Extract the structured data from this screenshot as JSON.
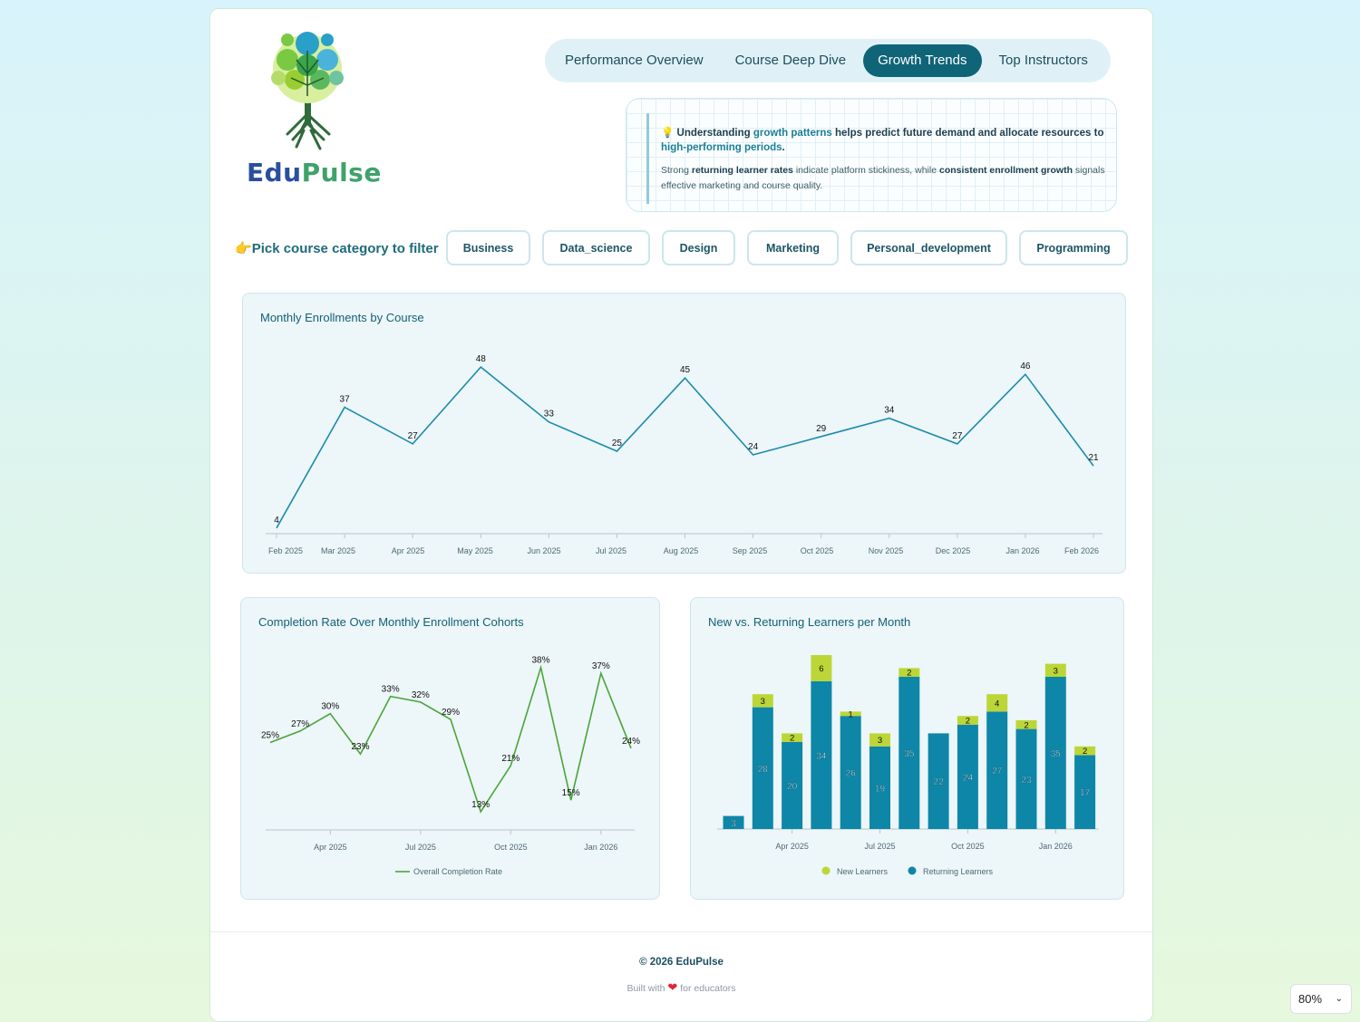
{
  "app": {
    "brand_a": "Edu",
    "brand_b": "Pulse"
  },
  "nav": {
    "tabs": [
      {
        "label": "Performance Overview",
        "active": false
      },
      {
        "label": "Course Deep Dive",
        "active": false
      },
      {
        "label": "Growth Trends",
        "active": true
      },
      {
        "label": "Top Instructors",
        "active": false
      }
    ]
  },
  "insight": {
    "icon": "lightbulb-icon",
    "line1_a": "Understanding ",
    "line1_hl": "growth patterns",
    "line1_b": " helps predict future demand and allocate resources to ",
    "line1_hl2": "high-performing periods",
    "line1_c": ".",
    "line2_a": "Strong ",
    "line2_b1": "returning learner rates",
    "line2_c": " indicate platform stickiness, while ",
    "line2_b2": "consistent enrollment growth",
    "line2_d": " signals effective marketing and course quality."
  },
  "filter": {
    "label": "Pick course category to filter",
    "icon": "pointing-hand-icon",
    "categories": [
      "Business",
      "Data_science",
      "Design",
      "Marketing",
      "Personal_development",
      "Programming"
    ]
  },
  "panels": {
    "enrollments_title": "Monthly Enrollments by Course",
    "completion_title": "Completion Rate Over Monthly Enrollment Cohorts",
    "learners_title": "New vs. Returning Learners per Month"
  },
  "chart_data": [
    {
      "type": "line",
      "title": "Monthly Enrollments by Course",
      "x": [
        "Feb 2025",
        "Mar 2025",
        "Apr 2025",
        "May 2025",
        "Jun 2025",
        "Jul 2025",
        "Aug 2025",
        "Sep 2025",
        "Oct 2025",
        "Nov 2025",
        "Dec 2025",
        "Jan 2026",
        "Feb 2026"
      ],
      "values": [
        4,
        37,
        27,
        48,
        33,
        25,
        45,
        24,
        29,
        34,
        27,
        46,
        21
      ],
      "ylim": [
        0,
        50
      ],
      "color": "#1a8cac"
    },
    {
      "type": "line",
      "title": "Completion Rate Over Monthly Enrollment Cohorts",
      "x": [
        "Feb 2025",
        "Mar 2025",
        "Apr 2025",
        "May 2025",
        "Jun 2025",
        "Jul 2025",
        "Aug 2025",
        "Sep 2025",
        "Oct 2025",
        "Nov 2025",
        "Dec 2025",
        "Jan 2026",
        "Feb 2026"
      ],
      "x_ticks": [
        "Apr 2025",
        "Jul 2025",
        "Oct 2025",
        "Jan 2026"
      ],
      "series": [
        {
          "name": "Overall Completion Rate",
          "values": [
            25,
            27,
            30,
            23,
            33,
            32,
            29,
            13,
            21,
            38,
            15,
            37,
            24
          ]
        }
      ],
      "value_suffix": "%",
      "ylim": [
        10,
        40
      ],
      "color": "#4aa53a",
      "legend": "bottom"
    },
    {
      "type": "bar",
      "stacked": true,
      "title": "New vs. Returning Learners per Month",
      "x": [
        "Feb 2025",
        "Mar 2025",
        "Apr 2025",
        "May 2025",
        "Jun 2025",
        "Jul 2025",
        "Aug 2025",
        "Sep 2025",
        "Oct 2025",
        "Nov 2025",
        "Dec 2025",
        "Jan 2026",
        "Feb 2026"
      ],
      "x_ticks": [
        "Apr 2025",
        "Jul 2025",
        "Oct 2025",
        "Jan 2026"
      ],
      "series": [
        {
          "name": "Returning Learners",
          "color": "#0e86a8",
          "values": [
            3,
            28,
            20,
            34,
            26,
            19,
            35,
            22,
            24,
            27,
            23,
            35,
            17
          ]
        },
        {
          "name": "New Learners",
          "color": "#bcd638",
          "values": [
            0,
            3,
            2,
            6,
            1,
            3,
            2,
            0,
            2,
            4,
            2,
            3,
            2
          ]
        }
      ],
      "ylim": [
        0,
        40
      ],
      "legend": "bottom"
    }
  ],
  "footer": {
    "copyright": "© 2026 EduPulse",
    "built_a": "Built with",
    "heart": "❤",
    "built_b": "for educators"
  },
  "zoom": {
    "value": "80%"
  }
}
